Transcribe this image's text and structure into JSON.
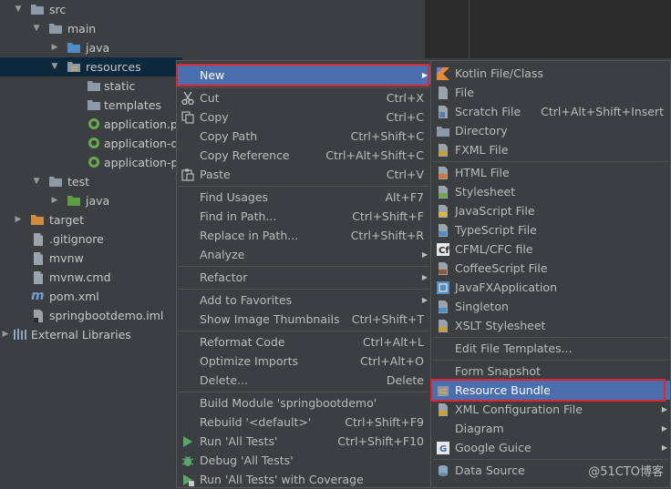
{
  "tree": {
    "items": [
      {
        "label": "src",
        "arrow": "down",
        "icon": "folder-icon"
      },
      {
        "label": "main",
        "arrow": "down",
        "icon": "folder-icon"
      },
      {
        "label": "java",
        "arrow": "right",
        "icon": "source-folder-icon"
      },
      {
        "label": "resources",
        "arrow": "down",
        "icon": "resources-folder-icon"
      },
      {
        "label": "static",
        "icon": "folder-icon"
      },
      {
        "label": "templates",
        "icon": "folder-icon"
      },
      {
        "label": "application.pr",
        "icon": "spring-properties-icon"
      },
      {
        "label": "application-de",
        "icon": "spring-properties-icon"
      },
      {
        "label": "application-pr",
        "icon": "spring-properties-icon"
      },
      {
        "label": "test",
        "arrow": "down",
        "icon": "folder-icon"
      },
      {
        "label": "java",
        "arrow": "right",
        "icon": "test-folder-icon"
      },
      {
        "label": "target",
        "arrow": "right",
        "icon": "excluded-folder-icon"
      },
      {
        "label": ".gitignore",
        "icon": "file-icon"
      },
      {
        "label": "mvnw",
        "icon": "file-icon"
      },
      {
        "label": "mvnw.cmd",
        "icon": "file-icon"
      },
      {
        "label": "pom.xml",
        "icon": "maven-icon"
      },
      {
        "label": "springbootdemo.iml",
        "icon": "module-file-icon"
      },
      {
        "label": "External Libraries",
        "arrow": "right",
        "icon": "libraries-icon"
      }
    ]
  },
  "context_menu": {
    "items": [
      {
        "label": "New",
        "shortcut": "",
        "submenu": true
      },
      {
        "label": "Cut",
        "shortcut": "Ctrl+X"
      },
      {
        "label": "Copy",
        "shortcut": "Ctrl+C"
      },
      {
        "label": "Copy Path",
        "shortcut": "Ctrl+Shift+C"
      },
      {
        "label": "Copy Reference",
        "shortcut": "Ctrl+Alt+Shift+C"
      },
      {
        "label": "Paste",
        "shortcut": "Ctrl+V"
      },
      {
        "label": "Find Usages",
        "shortcut": "Alt+F7"
      },
      {
        "label": "Find in Path...",
        "shortcut": "Ctrl+Shift+F"
      },
      {
        "label": "Replace in Path...",
        "shortcut": "Ctrl+Shift+R"
      },
      {
        "label": "Analyze",
        "shortcut": "",
        "submenu": true
      },
      {
        "label": "Refactor",
        "shortcut": "",
        "submenu": true
      },
      {
        "label": "Add to Favorites",
        "shortcut": "",
        "submenu": true
      },
      {
        "label": "Show Image Thumbnails",
        "shortcut": "Ctrl+Shift+T"
      },
      {
        "label": "Reformat Code",
        "shortcut": "Ctrl+Alt+L"
      },
      {
        "label": "Optimize Imports",
        "shortcut": "Ctrl+Alt+O"
      },
      {
        "label": "Delete...",
        "shortcut": "Delete"
      },
      {
        "label": "Build Module 'springbootdemo'",
        "shortcut": ""
      },
      {
        "label": "Rebuild '<default>'",
        "shortcut": "Ctrl+Shift+F9"
      },
      {
        "label": "Run 'All Tests'",
        "shortcut": "Ctrl+Shift+F10"
      },
      {
        "label": "Debug 'All Tests'",
        "shortcut": ""
      },
      {
        "label": "Run 'All Tests' with Coverage",
        "shortcut": ""
      }
    ]
  },
  "new_submenu": {
    "items": [
      {
        "label": "Kotlin File/Class",
        "shortcut": ""
      },
      {
        "label": "File",
        "shortcut": ""
      },
      {
        "label": "Scratch File",
        "shortcut": "Ctrl+Alt+Shift+Insert"
      },
      {
        "label": "Directory",
        "shortcut": ""
      },
      {
        "label": "FXML File",
        "shortcut": ""
      },
      {
        "label": "HTML File",
        "shortcut": ""
      },
      {
        "label": "Stylesheet",
        "shortcut": ""
      },
      {
        "label": "JavaScript File",
        "shortcut": ""
      },
      {
        "label": "TypeScript File",
        "shortcut": ""
      },
      {
        "label": "CFML/CFC file",
        "shortcut": ""
      },
      {
        "label": "CoffeeScript File",
        "shortcut": ""
      },
      {
        "label": "JavaFXApplication",
        "shortcut": ""
      },
      {
        "label": "Singleton",
        "shortcut": ""
      },
      {
        "label": "XSLT Stylesheet",
        "shortcut": ""
      },
      {
        "label": "Edit File Templates...",
        "shortcut": ""
      },
      {
        "label": "Form Snapshot",
        "shortcut": ""
      },
      {
        "label": "Resource Bundle",
        "shortcut": ""
      },
      {
        "label": "XML Configuration File",
        "shortcut": "",
        "submenu": true
      },
      {
        "label": "Diagram",
        "shortcut": "",
        "submenu": true
      },
      {
        "label": "Google Guice",
        "shortcut": "",
        "submenu": true
      },
      {
        "label": "Data Source",
        "shortcut": ""
      }
    ]
  },
  "watermark": "@51CTO博客",
  "colors": {
    "background": "#3c3f41",
    "selection": "#4b6eaf",
    "tree_selection": "#0d293e",
    "highlight_border": "#e0252d"
  }
}
